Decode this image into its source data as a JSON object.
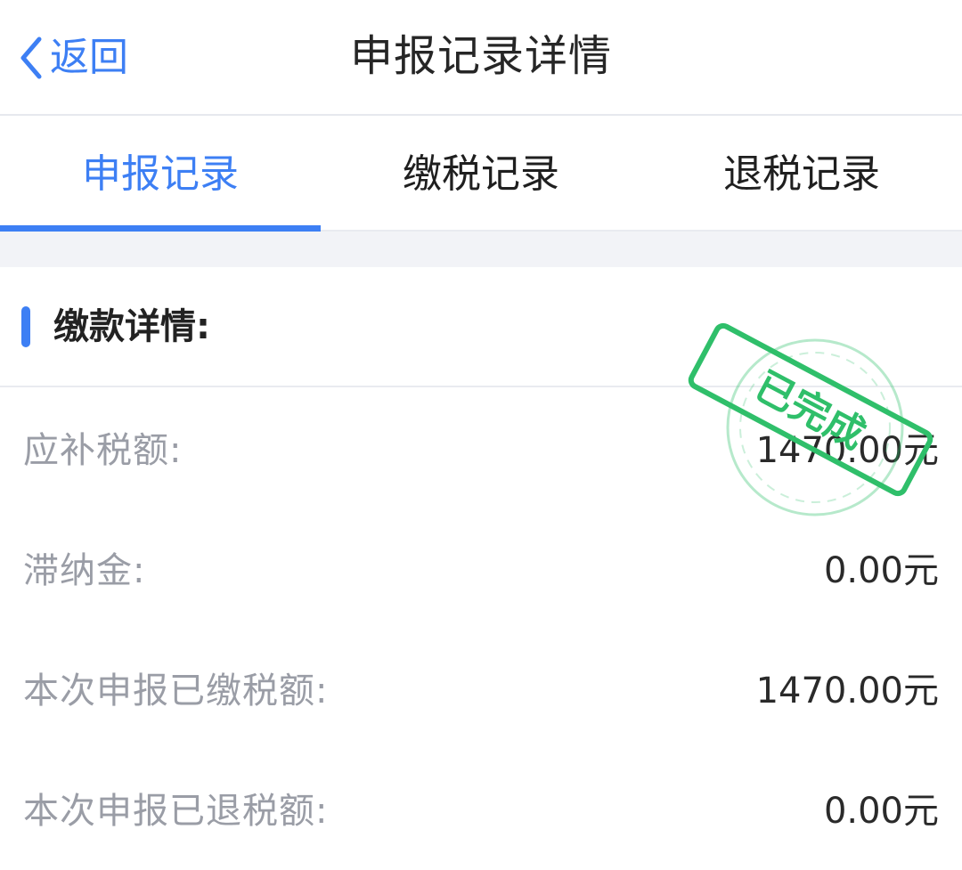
{
  "navbar": {
    "back_label": "返回",
    "title": "申报记录详情"
  },
  "tabs": [
    {
      "label": "申报记录",
      "active": true
    },
    {
      "label": "缴税记录",
      "active": false
    },
    {
      "label": "退税记录",
      "active": false
    }
  ],
  "section": {
    "title": "缴款详情:"
  },
  "rows": [
    {
      "label": "应补税额:",
      "value": "1470.00元"
    },
    {
      "label": "滞纳金:",
      "value": "0.00元"
    },
    {
      "label": "本次申报已缴税额:",
      "value": "1470.00元"
    },
    {
      "label": "本次申报已退税额:",
      "value": "0.00元"
    }
  ],
  "stamp": {
    "text": "已完成",
    "color": "#2fbf6a"
  },
  "colors": {
    "accent": "#3d7ff4",
    "label_gray": "#9a9da6",
    "value_dark": "#2a2a2a"
  },
  "icons": {
    "back": "chevron-left-icon"
  }
}
